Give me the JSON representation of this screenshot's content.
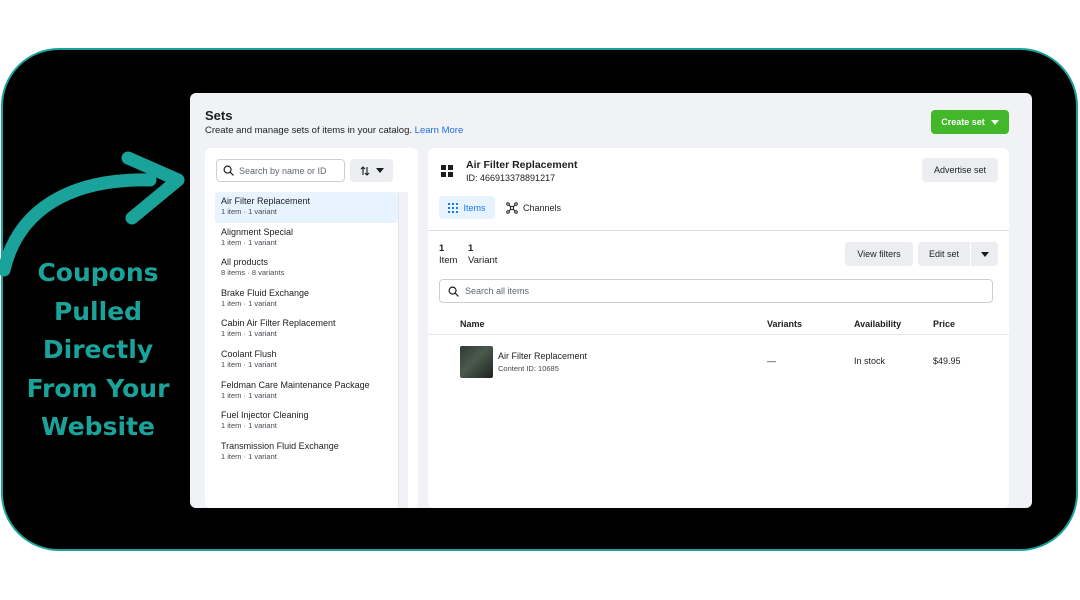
{
  "promo": {
    "line1": "Coupons",
    "line2": "Pulled",
    "line3": "Directly",
    "line4": "From Your",
    "line5": "Website",
    "accent_color": "#1aa39a"
  },
  "header": {
    "title": "Sets",
    "subtitle": "Create and manage sets of items in your catalog.",
    "learn_more": "Learn More",
    "create_button": "Create set"
  },
  "sidebar": {
    "search_placeholder": "Search by name or ID",
    "sort_icon": "sort-arrows-icon",
    "items": [
      {
        "name": "Air Filter Replacement",
        "meta": "1 item · 1 variant",
        "selected": true
      },
      {
        "name": "Alignment Special",
        "meta": "1 item · 1 variant"
      },
      {
        "name": "All products",
        "meta": "8 items · 8 variants"
      },
      {
        "name": "Brake Fluid Exchange",
        "meta": "1 item · 1 variant"
      },
      {
        "name": "Cabin Air Filter Replacement",
        "meta": "1 item · 1 variant"
      },
      {
        "name": "Coolant Flush",
        "meta": "1 item · 1 variant"
      },
      {
        "name": "Feldman Care Maintenance Package",
        "meta": "1 item · 1 variant"
      },
      {
        "name": "Fuel Injector Cleaning",
        "meta": "1 item · 1 variant"
      },
      {
        "name": "Transmission Fluid Exchange",
        "meta": "1 item · 1 variant"
      }
    ]
  },
  "detail": {
    "title": "Air Filter Replacement",
    "id_label": "ID: 466913378891217",
    "advertise_button": "Advertise set",
    "tabs": [
      {
        "label": "Items",
        "icon": "grid-icon",
        "active": true
      },
      {
        "label": "Channels",
        "icon": "channels-icon"
      }
    ],
    "counts": {
      "items_value": "1",
      "items_label": "Item",
      "variants_value": "1",
      "variants_label": "Variant"
    },
    "view_filters_button": "View filters",
    "edit_set_button": "Edit set",
    "search_placeholder": "Search all items",
    "table": {
      "columns": [
        "Name",
        "Variants",
        "Availability",
        "Price"
      ],
      "rows": [
        {
          "name": "Air Filter Replacement",
          "content_id": "Content ID: 10685",
          "variants": "—",
          "availability": "In stock",
          "price": "$49.95"
        }
      ]
    }
  },
  "colors": {
    "brand_blue": "#1877f2",
    "create_green": "#42b72a",
    "frame_teal": "#1aa39a"
  }
}
